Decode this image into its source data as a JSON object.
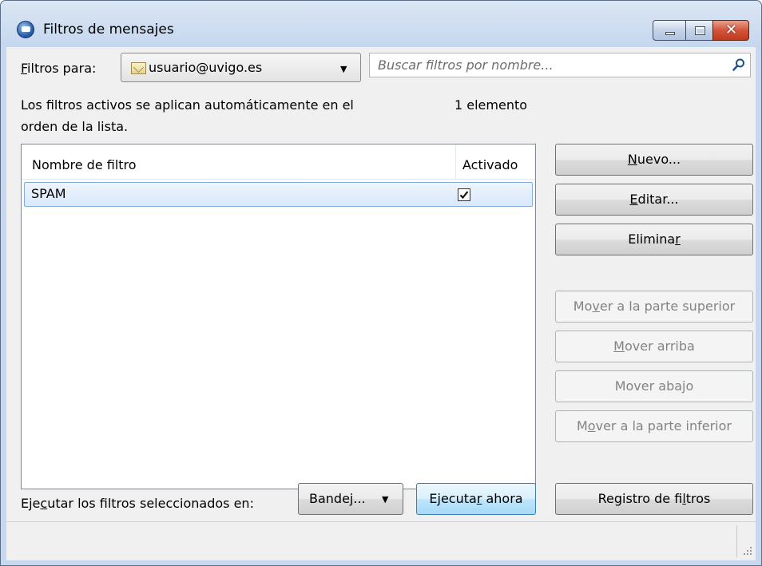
{
  "window": {
    "title": "Filtros de mensajes"
  },
  "filters_for": {
    "label_prefix": "F",
    "label_rest": "iltros para:",
    "account": "usuario@uvigo.es"
  },
  "search": {
    "placeholder": "Buscar filtros por nombre..."
  },
  "info": {
    "line1": "Los filtros activos se aplican automáticamente en el",
    "line2": "orden de la lista.",
    "count": "1 elemento"
  },
  "list": {
    "columns": [
      "Nombre de filtro",
      "Activado"
    ],
    "rows": [
      {
        "name": "SPAM",
        "enabled": true
      }
    ]
  },
  "buttons": {
    "new": {
      "pre": "",
      "key": "N",
      "post": "uevo..."
    },
    "edit": {
      "pre": "",
      "key": "E",
      "post": "ditar..."
    },
    "delete": {
      "pre": "Elimina",
      "key": "r",
      "post": ""
    },
    "move_top": {
      "pre": "Mo",
      "key": "v",
      "post": "er a la parte superior"
    },
    "move_up": {
      "pre": "",
      "key": "M",
      "post": "over arriba"
    },
    "move_down": {
      "pre": "Mover aba",
      "key": "j",
      "post": "o"
    },
    "move_bottom": {
      "pre": "M",
      "key": "o",
      "post": "ver a la parte inferior"
    },
    "run_now": {
      "pre": "Ejecuta",
      "key": "r",
      "post": " ahora"
    },
    "filter_log": {
      "pre": "Registro de fi",
      "key": "l",
      "post": "tros"
    }
  },
  "run": {
    "label_pre": "Eje",
    "label_key": "c",
    "label_post": "utar los filtros seleccionados en:",
    "folder": "Bandej..."
  },
  "colors": {
    "window_frame": "#c7d8ee",
    "client_bg": "#f0f0f0",
    "close_button": "#c23a1c",
    "selection": "#d9e8fb"
  },
  "icons": [
    "thunderbird-icon",
    "minimize-icon",
    "maximize-icon",
    "close-icon",
    "mail-account-icon",
    "search-icon",
    "checkbox-checked-icon",
    "resize-grip-icon"
  ]
}
